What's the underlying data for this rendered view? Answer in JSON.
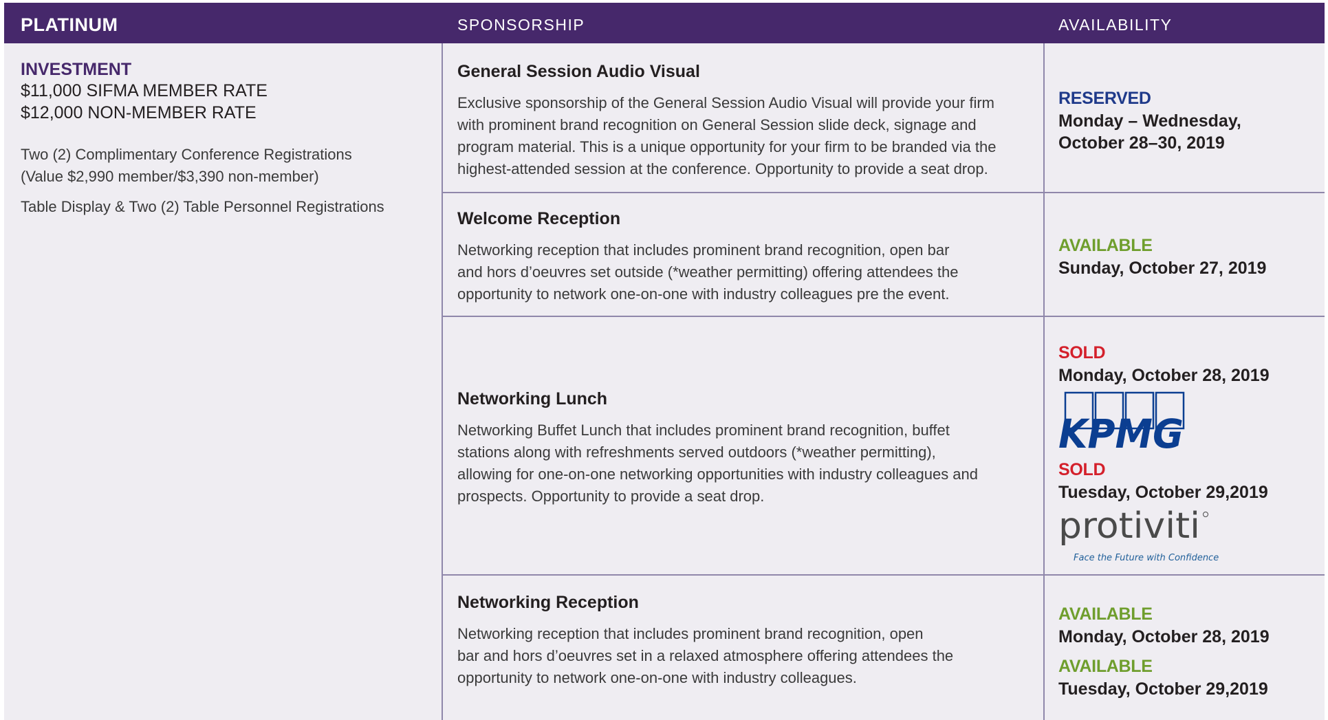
{
  "header": {
    "tier": "PLATINUM",
    "sponsorship": "SPONSORSHIP",
    "availability": "AVAILABILITY"
  },
  "investment": {
    "label": "INVESTMENT",
    "member_rate": "$11,000 SIFMA MEMBER RATE",
    "non_member_rate": "$12,000 NON-MEMBER RATE",
    "benefits": [
      "Two (2) Complimentary Conference Registrations",
      "(Value $2,990 member/$3,390 non-member)",
      "Table Display & Two (2) Table Personnel Registrations"
    ]
  },
  "sponsorships": [
    {
      "title": "General Session Audio Visual",
      "description": [
        "Exclusive sponsorship of the General Session Audio Visual will provide your firm",
        "with prominent brand recognition on General Session slide deck, signage and",
        "program material. This is a unique opportunity for your firm to be branded via the",
        "highest-attended session at the conference. Opportunity to provide a seat drop."
      ],
      "availability": [
        {
          "status": "RESERVED",
          "date_lines": [
            "Monday – Wednesday,",
            "October 28–30, 2019"
          ]
        }
      ]
    },
    {
      "title": "Welcome Reception",
      "description": [
        "Networking reception that includes prominent brand recognition, open bar",
        "and hors d’oeuvres set outside (*weather permitting) offering attendees the",
        "opportunity to network one-on-one with industry colleagues pre the event."
      ],
      "availability": [
        {
          "status": "AVAILABLE",
          "date_lines": [
            "Sunday, October 27, 2019"
          ]
        }
      ]
    },
    {
      "title": "Networking Lunch",
      "description": [
        "Networking Buffet Lunch that includes prominent brand recognition, buffet",
        "stations along with refreshments served outdoors (*weather permitting),",
        "allowing for one-on-one networking opportunities with industry colleagues and",
        "prospects. Opportunity to provide a seat drop."
      ],
      "availability": [
        {
          "status": "SOLD",
          "date_lines": [
            "Monday, October 28, 2019"
          ],
          "sponsor_logo": "KPMG"
        },
        {
          "status": "SOLD",
          "date_lines": [
            "Tuesday, October 29,2019"
          ],
          "sponsor_logo": "protiviti",
          "sponsor_tagline": "Face the Future with Confidence"
        }
      ]
    },
    {
      "title": "Networking Reception",
      "description": [
        "Networking reception that includes prominent brand recognition, open",
        "bar and hors d’oeuvres set in a relaxed atmosphere offering attendees the",
        "opportunity to network one-on-one with industry colleagues."
      ],
      "availability": [
        {
          "status": "AVAILABLE",
          "date_lines": [
            "Monday, October 28, 2019"
          ]
        },
        {
          "status": "AVAILABLE",
          "date_lines": [
            "Tuesday, October 29,2019"
          ]
        }
      ]
    }
  ],
  "colors": {
    "header_bg": "#46286b",
    "table_bg": "#efedf2",
    "rule": "#8f87aa",
    "reserved": "#1f3a8a",
    "available": "#6f9e2d",
    "sold": "#d4202b",
    "kpmg_blue": "#0b3e91",
    "protiviti_grey": "#4a4a4a",
    "protiviti_blue": "#1f5f99"
  }
}
